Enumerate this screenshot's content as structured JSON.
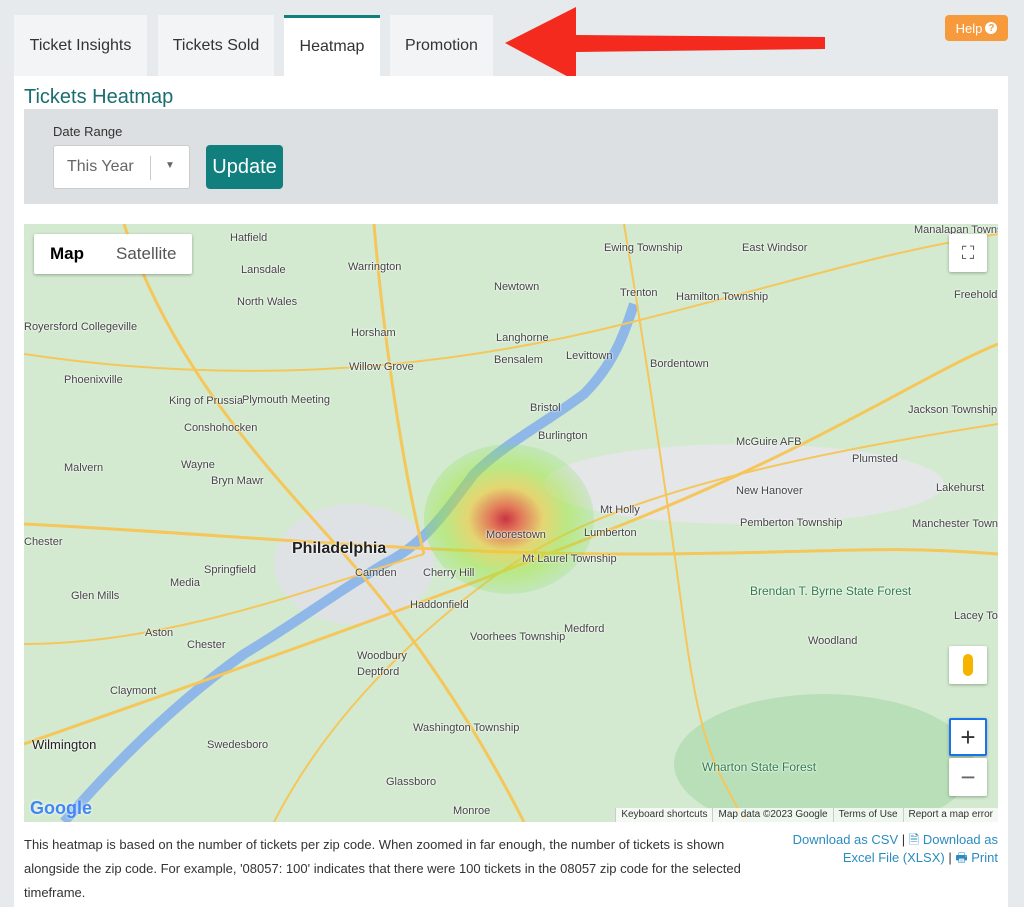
{
  "tabs": [
    {
      "label": "Ticket Insights",
      "active": false
    },
    {
      "label": "Tickets Sold",
      "active": false
    },
    {
      "label": "Heatmap",
      "active": true
    },
    {
      "label": "Promotion",
      "active": false
    }
  ],
  "help": {
    "label": "Help",
    "icon": "question-circle-icon"
  },
  "annotation_arrow_color": "#f42a1e",
  "page_title": "Tickets Heatmap",
  "filters": {
    "date_range_label": "Date Range",
    "date_range_value": "This Year",
    "update_label": "Update"
  },
  "map": {
    "type_buttons": [
      "Map",
      "Satellite"
    ],
    "active_type": "Map",
    "places": [
      "Hatfield",
      "Warrington",
      "Ewing Township",
      "Trenton",
      "Hamilton Township",
      "East Windsor",
      "Lansdale",
      "North Wales",
      "Newtown",
      "Royersford Collegeville",
      "Horsham",
      "Langhorne",
      "Levittown",
      "Bordentown",
      "Freehold Township",
      "Phoenixville",
      "Willow Grove",
      "Bensalem",
      "Plymouth Meeting",
      "King of Prussia",
      "Conshohocken",
      "Bristol",
      "Jackson Township",
      "Burlington",
      "Malvern",
      "Wayne",
      "Bryn Mawr",
      "McGuire AFB",
      "Plumsted",
      "New Hanover",
      "Lakehurst",
      "Mt Holly",
      "Philadelphia",
      "Moorestown",
      "Lumberton",
      "Pemberton Township",
      "Manchester Township",
      "Chester",
      "Springfield",
      "Camden",
      "Cherry Hill",
      "Mt Laurel Township",
      "Media",
      "Glen Mills",
      "Haddonfield",
      "Brendan T. Byrne State Forest",
      "Medford",
      "Lacey Township",
      "Aston",
      "Chester",
      "Voorhees Township",
      "Woodland",
      "Woodbury",
      "Deptford",
      "Claymont",
      "Washington Township",
      "Swedesboro",
      "Wilmington",
      "Wharton State Forest",
      "Glassboro",
      "Monroe",
      "Manalapan Township"
    ],
    "attribution": [
      "Keyboard shortcuts",
      "Map data ©2023 Google",
      "Terms of Use",
      "Report a map error"
    ],
    "logo": "Google",
    "zoom_in": "+",
    "zoom_out": "−"
  },
  "description": "This heatmap is based on the number of tickets per zip code. When zoomed in far enough, the number of tickets is shown alongside the zip code. For example, '08057: 100' indicates that there were 100 tickets in the 08057 zip code for the selected timeframe.",
  "downloads": {
    "csv": "Download as CSV",
    "xlsx": "Download as Excel File (XLSX)",
    "print": "Print",
    "separator": "|"
  }
}
